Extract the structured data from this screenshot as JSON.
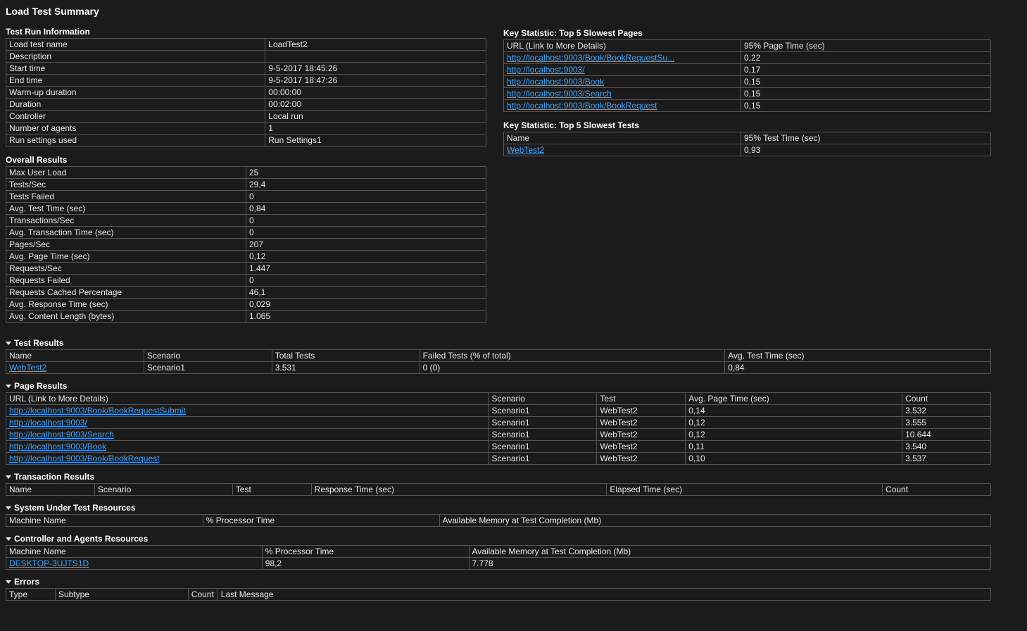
{
  "page_title": "Load Test Summary",
  "sections": {
    "test_run_info_title": "Test Run Information",
    "overall_results_title": "Overall Results",
    "slowest_pages_title": "Key Statistic: Top 5 Slowest Pages",
    "slowest_tests_title": "Key Statistic: Top 5 Slowest Tests",
    "test_results_title": "Test Results",
    "page_results_title": "Page Results",
    "transaction_results_title": "Transaction Results",
    "system_resources_title": "System Under Test Resources",
    "controller_resources_title": "Controller and Agents Resources",
    "errors_title": "Errors"
  },
  "test_run_info_rows": [
    {
      "label": "Load test name",
      "value": "LoadTest2"
    },
    {
      "label": "Description",
      "value": ""
    },
    {
      "label": "Start time",
      "value": "9-5-2017 18:45:26"
    },
    {
      "label": "End time",
      "value": "9-5-2017 18:47:26"
    },
    {
      "label": "Warm-up duration",
      "value": "00:00:00"
    },
    {
      "label": "Duration",
      "value": "00:02:00"
    },
    {
      "label": "Controller",
      "value": "Local run"
    },
    {
      "label": "Number of agents",
      "value": "1"
    },
    {
      "label": "Run settings used",
      "value": "Run Settings1"
    }
  ],
  "overall_results_rows": [
    {
      "label": "Max User Load",
      "value": "25"
    },
    {
      "label": "Tests/Sec",
      "value": "29,4"
    },
    {
      "label": "Tests Failed",
      "value": "0"
    },
    {
      "label": "Avg. Test Time (sec)",
      "value": "0,84"
    },
    {
      "label": "Transactions/Sec",
      "value": "0"
    },
    {
      "label": "Avg. Transaction Time (sec)",
      "value": "0"
    },
    {
      "label": "Pages/Sec",
      "value": "207"
    },
    {
      "label": "Avg. Page Time (sec)",
      "value": "0,12"
    },
    {
      "label": "Requests/Sec",
      "value": "1.447"
    },
    {
      "label": "Requests Failed",
      "value": "0"
    },
    {
      "label": "Requests Cached Percentage",
      "value": "46,1"
    },
    {
      "label": "Avg. Response Time (sec)",
      "value": "0,029"
    },
    {
      "label": "Avg. Content Length (bytes)",
      "value": "1.065"
    }
  ],
  "slowest_pages_headers": [
    "URL (Link to More Details)",
    "95% Page Time (sec)"
  ],
  "slowest_pages_rows": [
    {
      "url": "http://localhost:9003/Book/BookRequestSu...",
      "time": "0,22"
    },
    {
      "url": "http://localhost:9003/",
      "time": "0,17"
    },
    {
      "url": "http://localhost:9003/Book",
      "time": "0,15"
    },
    {
      "url": "http://localhost:9003/Search",
      "time": "0,15"
    },
    {
      "url": "http://localhost:9003/Book/BookRequest",
      "time": "0,15"
    }
  ],
  "slowest_tests_headers": [
    "Name",
    "95% Test Time (sec)"
  ],
  "slowest_tests_rows": [
    {
      "name": "WebTest2",
      "time": "0,93"
    }
  ],
  "test_results_headers": [
    "Name",
    "Scenario",
    "Total Tests",
    "Failed Tests (% of total)",
    "Avg. Test Time (sec)"
  ],
  "test_results_rows": [
    {
      "name": "WebTest2",
      "scenario": "Scenario1",
      "total": "3.531",
      "failed": "0 (0)",
      "avg": "0,84"
    }
  ],
  "page_results_headers": [
    "URL (Link to More Details)",
    "Scenario",
    "Test",
    "Avg. Page Time (sec)",
    "Count"
  ],
  "page_results_rows": [
    {
      "url": "http://localhost:9003/Book/BookRequestSubmit",
      "scenario": "Scenario1",
      "test": "WebTest2",
      "avg": "0,14",
      "count": "3.532"
    },
    {
      "url": "http://localhost:9003/",
      "scenario": "Scenario1",
      "test": "WebTest2",
      "avg": "0,12",
      "count": "3.555"
    },
    {
      "url": "http://localhost:9003/Search",
      "scenario": "Scenario1",
      "test": "WebTest2",
      "avg": "0,12",
      "count": "10.644"
    },
    {
      "url": "http://localhost:9003/Book",
      "scenario": "Scenario1",
      "test": "WebTest2",
      "avg": "0,11",
      "count": "3.540"
    },
    {
      "url": "http://localhost:9003/Book/BookRequest",
      "scenario": "Scenario1",
      "test": "WebTest2",
      "avg": "0,10",
      "count": "3.537"
    }
  ],
  "transaction_results_headers": [
    "Name",
    "Scenario",
    "Test",
    "Response Time (sec)",
    "Elapsed Time (sec)",
    "Count"
  ],
  "system_resources_headers": [
    "Machine Name",
    "% Processor Time",
    "Available Memory at Test Completion (Mb)"
  ],
  "controller_resources_headers": [
    "Machine Name",
    "% Processor Time",
    "Available Memory at Test Completion (Mb)"
  ],
  "controller_resources_rows": [
    {
      "machine": "DESKTOP-3UJTS1D",
      "cpu": "98,2",
      "mem": "7.778"
    }
  ],
  "errors_headers": [
    "Type",
    "Subtype",
    "Count",
    "Last Message"
  ]
}
